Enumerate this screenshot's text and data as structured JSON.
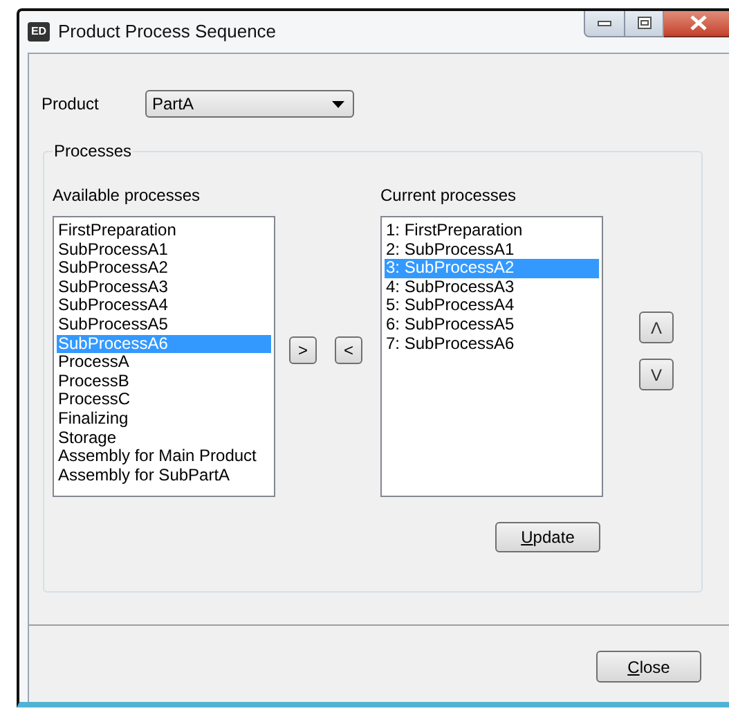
{
  "window": {
    "title": "Product Process Sequence",
    "icon_text": "ED"
  },
  "product": {
    "label": "Product",
    "value": "PartA"
  },
  "processes": {
    "title": "Processes",
    "available": {
      "label": "Available processes",
      "items": [
        {
          "text": "FirstPreparation",
          "selected": false
        },
        {
          "text": "SubProcessA1",
          "selected": false
        },
        {
          "text": "SubProcessA2",
          "selected": false
        },
        {
          "text": "SubProcessA3",
          "selected": false
        },
        {
          "text": "SubProcessA4",
          "selected": false
        },
        {
          "text": "SubProcessA5",
          "selected": false
        },
        {
          "text": "SubProcessA6",
          "selected": true
        },
        {
          "text": "ProcessA",
          "selected": false
        },
        {
          "text": "ProcessB",
          "selected": false
        },
        {
          "text": "ProcessC",
          "selected": false
        },
        {
          "text": "Finalizing",
          "selected": false
        },
        {
          "text": "Storage",
          "selected": false
        },
        {
          "text": "Assembly for Main Product",
          "selected": false
        },
        {
          "text": "Assembly for SubPartA",
          "selected": false
        }
      ]
    },
    "move_buttons": [
      ">",
      "<"
    ],
    "current": {
      "label": "Current processes",
      "items": [
        {
          "text": "1: FirstPreparation",
          "selected": false
        },
        {
          "text": "2: SubProcessA1",
          "selected": false
        },
        {
          "text": "3: SubProcessA2",
          "selected": true
        },
        {
          "text": "4: SubProcessA3",
          "selected": false
        },
        {
          "text": "5: SubProcessA4",
          "selected": false
        },
        {
          "text": "6: SubProcessA5",
          "selected": false
        },
        {
          "text": "7: SubProcessA6",
          "selected": false
        }
      ]
    },
    "order_buttons": [
      "Λ",
      "V"
    ],
    "update_button": {
      "label": "Update",
      "access_key_underlined": true
    }
  },
  "close_button": {
    "label": "Close",
    "access_key_underlined": true
  }
}
